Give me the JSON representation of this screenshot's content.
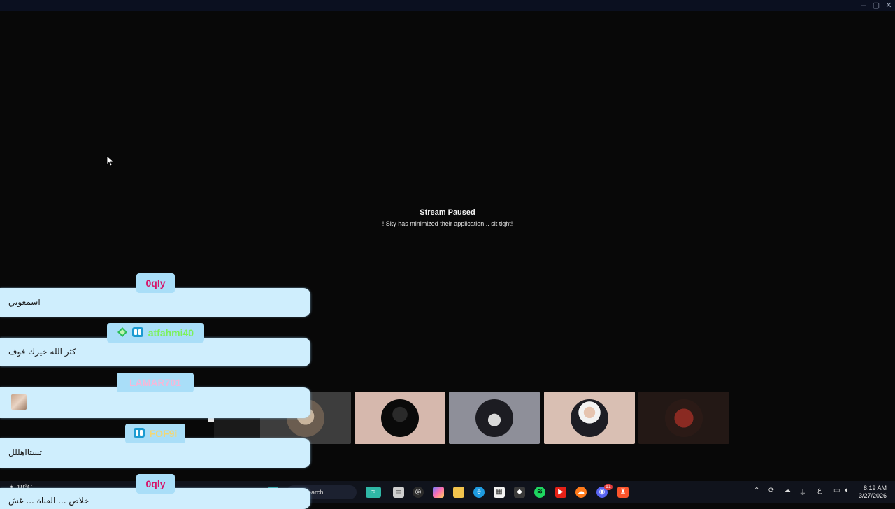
{
  "stream": {
    "title": "Stream Paused",
    "subtitle": "! Sky has minimized their application... sit tight!"
  },
  "chat": [
    {
      "user": "0qly",
      "user_color": "#d6146a",
      "message": "اسمعوني"
    },
    {
      "user": "atfahmi40",
      "user_color": "#7cf15a",
      "message": "كثر الله خيرك فوف"
    },
    {
      "user": "LAMAR701",
      "user_color": "#f6b8d8",
      "message": ""
    },
    {
      "user": "FOF9i",
      "user_color": "#f3d774",
      "message": "تستااهللل"
    },
    {
      "user": "0qly",
      "user_color": "#d6146a",
      "message": "خلاص ...  القناة ... غش"
    }
  ],
  "colors": {
    "bubble": "#cfeefd",
    "nametag": "#a9def8",
    "background": "#080808",
    "taskbar": "#10131c"
  },
  "taskbar": {
    "weather": "18°C",
    "search_placeholder": "Search",
    "time": "8:19 AM",
    "date": "3/27/2026",
    "language": "ع",
    "discord_badge": "61",
    "apps": [
      "fish-icon",
      "files-icon",
      "obs-icon",
      "copilot-icon",
      "folder-icon",
      "edge-icon",
      "store-icon",
      "unity-icon",
      "spotify-icon",
      "youtube-icon",
      "soundcloud-icon",
      "discord-icon",
      "brave-icon"
    ]
  },
  "window_controls": [
    "minimize",
    "maximize",
    "close"
  ]
}
